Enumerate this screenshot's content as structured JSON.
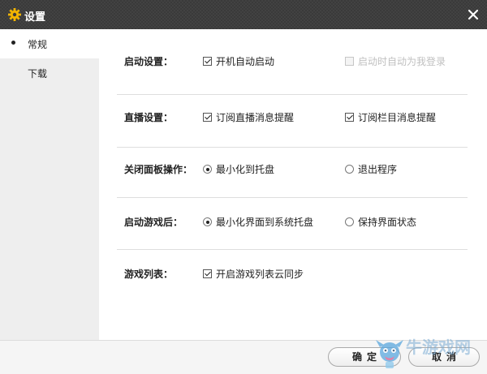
{
  "window": {
    "title": "设置",
    "icon": "gear-icon",
    "close_icon": "close-icon"
  },
  "sidebar": {
    "items": [
      {
        "label": "常规",
        "active": true
      },
      {
        "label": "下载",
        "active": false
      }
    ]
  },
  "settings": {
    "startup": {
      "label": "启动设置：",
      "options": [
        {
          "label": "开机自动启动",
          "checked": true,
          "disabled": false
        },
        {
          "label": "启动时自动为我登录",
          "checked": false,
          "disabled": true
        }
      ]
    },
    "live": {
      "label": "直播设置：",
      "options": [
        {
          "label": "订阅直播消息提醒",
          "checked": true
        },
        {
          "label": "订阅栏目消息提醒",
          "checked": true
        }
      ]
    },
    "close_panel": {
      "label": "关闭面板操作：",
      "options": [
        {
          "label": "最小化到托盘",
          "selected": true
        },
        {
          "label": "退出程序",
          "selected": false
        }
      ]
    },
    "after_game_launch": {
      "label": "启动游戏后：",
      "options": [
        {
          "label": "最小化界面到系统托盘",
          "selected": true
        },
        {
          "label": "保持界面状态",
          "selected": false
        }
      ]
    },
    "game_list": {
      "label": "游戏列表：",
      "options": [
        {
          "label": "开启游戏列表云同步",
          "checked": true
        }
      ]
    }
  },
  "footer": {
    "confirm_label": "确定",
    "cancel_label": "取消"
  },
  "watermark": {
    "text": "牛游戏网"
  },
  "colors": {
    "titlebar": "#3a3a3a",
    "gear_icon": "#f2b400",
    "sidebar": "#eeeeee"
  }
}
